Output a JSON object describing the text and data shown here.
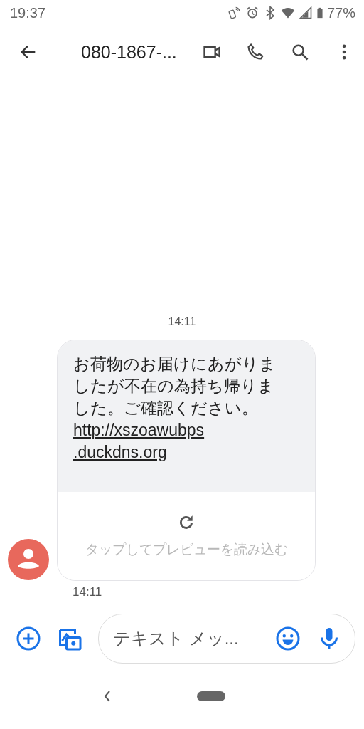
{
  "status_bar": {
    "time": "19:37",
    "battery": "77%"
  },
  "toolbar": {
    "title": "080-1867-..."
  },
  "conversation": {
    "date_stamp": "14:11",
    "message": {
      "text": "お荷物のお届けにあがりましたが不在の為持ち帰りました。ご確認ください。",
      "link_lines": [
        "http://xszoawubps",
        ".duckdns.org"
      ],
      "preview_label": "タップしてプレビューを読み込む",
      "time": "14:11"
    }
  },
  "compose": {
    "placeholder": "テキスト メッ..."
  }
}
